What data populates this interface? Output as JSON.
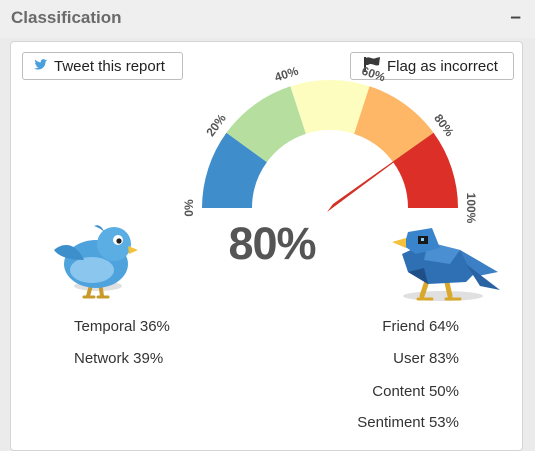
{
  "header": {
    "title": "Classification",
    "collapse_symbol": "–"
  },
  "buttons": {
    "tweet": {
      "label": "Tweet this report",
      "icon": "twitter-bird-icon"
    },
    "flag": {
      "label": "Flag as incorrect",
      "icon": "flag-icon"
    }
  },
  "gauge": {
    "value": 80,
    "value_label": "80%",
    "tick_labels": [
      "0%",
      "20%",
      "40%",
      "60%",
      "80%",
      "100%"
    ],
    "band_colors": [
      "#3f8ecb",
      "#b6df9f",
      "#fdfdbf",
      "#fdb766",
      "#dc2f27"
    ],
    "needle_color": "#d43126"
  },
  "left_stats": [
    {
      "text": "Temporal 36%"
    },
    {
      "text": "Network 39%"
    }
  ],
  "right_stats": [
    {
      "text": "Friend 64%"
    },
    {
      "text": "User 83%"
    },
    {
      "text": "Content 50%"
    },
    {
      "text": "Sentiment 53%"
    }
  ],
  "images": {
    "left": "human-bird-icon",
    "right": "robot-bird-icon"
  }
}
